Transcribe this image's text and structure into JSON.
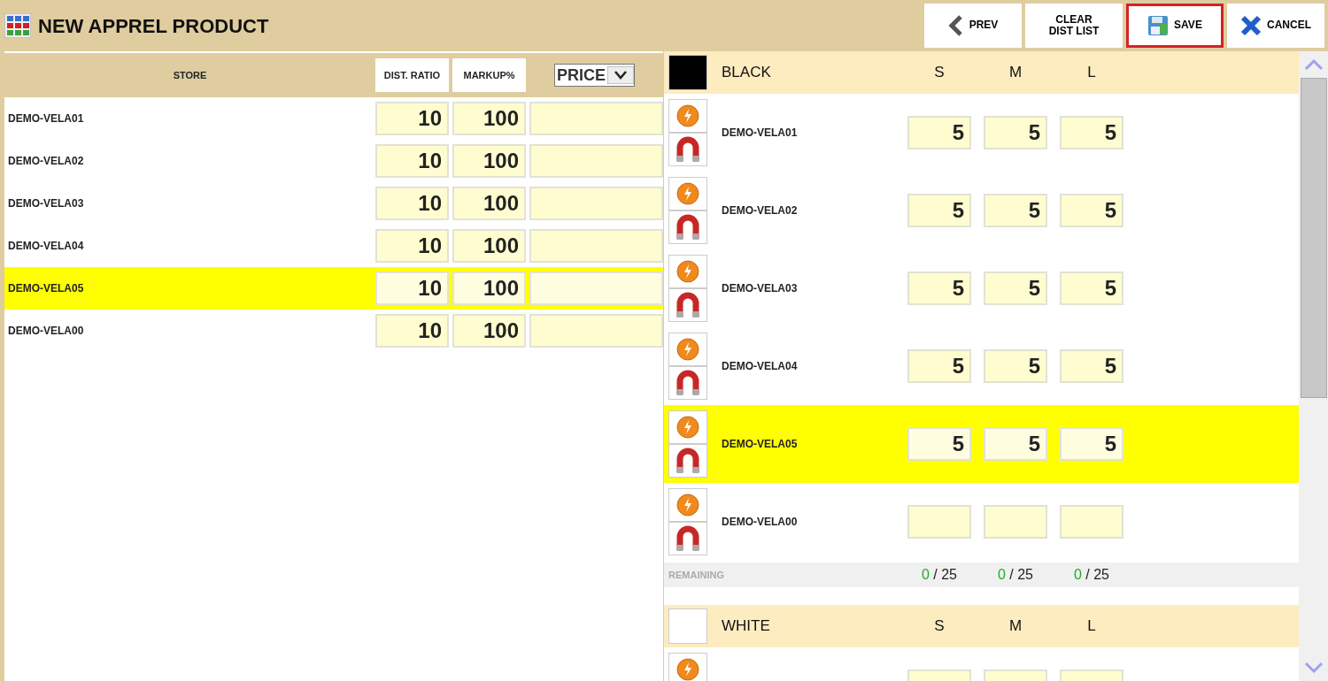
{
  "window": {
    "title": "NEW APPREL PRODUCT"
  },
  "toolbar": [
    {
      "kind": "prev",
      "label": "PREV",
      "focused": false
    },
    {
      "kind": "clear",
      "label": "CLEAR DIST LIST",
      "focused": false
    },
    {
      "kind": "save",
      "label": "SAVE",
      "focused": true
    },
    {
      "kind": "cancel",
      "label": "CANCEL",
      "focused": false
    }
  ],
  "store_table": {
    "columns": {
      "store": "STORE",
      "dist_ratio": "DIST. RATIO",
      "markup": "MARKUP%",
      "price": "PRICE"
    },
    "rows": [
      {
        "store": "DEMO-VELA01",
        "dist_ratio": "10",
        "markup": "100",
        "selected": false
      },
      {
        "store": "DEMO-VELA02",
        "dist_ratio": "10",
        "markup": "100",
        "selected": false
      },
      {
        "store": "DEMO-VELA03",
        "dist_ratio": "10",
        "markup": "100",
        "selected": false
      },
      {
        "store": "DEMO-VELA04",
        "dist_ratio": "10",
        "markup": "100",
        "selected": false
      },
      {
        "store": "DEMO-VELA05",
        "dist_ratio": "10",
        "markup": "100",
        "selected": true
      },
      {
        "store": "DEMO-VELA00",
        "dist_ratio": "10",
        "markup": "100",
        "selected": false
      }
    ]
  },
  "color_groups": [
    {
      "name": "BLACK",
      "color": "#000000",
      "sizes": [
        "S",
        "M",
        "L"
      ],
      "rows": [
        {
          "store": "DEMO-VELA01",
          "quantities": [
            "5",
            "5",
            "5"
          ],
          "selected": false
        },
        {
          "store": "DEMO-VELA02",
          "quantities": [
            "5",
            "5",
            "5"
          ],
          "selected": false
        },
        {
          "store": "DEMO-VELA03",
          "quantities": [
            "5",
            "5",
            "5"
          ],
          "selected": false
        },
        {
          "store": "DEMO-VELA04",
          "quantities": [
            "5",
            "5",
            "5"
          ],
          "selected": false
        },
        {
          "store": "DEMO-VELA05",
          "quantities": [
            "5",
            "5",
            "5"
          ],
          "selected": true
        },
        {
          "store": "DEMO-VELA00",
          "selected": false
        }
      ],
      "remaining": {
        "label": "REMAINING",
        "values": [
          {
            "count": "0",
            "total": "/ 25"
          },
          {
            "count": "0",
            "total": "/ 25"
          },
          {
            "count": "0",
            "total": "/ 25"
          }
        ]
      }
    },
    {
      "name": "WHITE",
      "color": "#ffffff",
      "sizes": [
        "S",
        "M",
        "L"
      ],
      "rows": [
        {
          "selected": false
        }
      ]
    }
  ]
}
